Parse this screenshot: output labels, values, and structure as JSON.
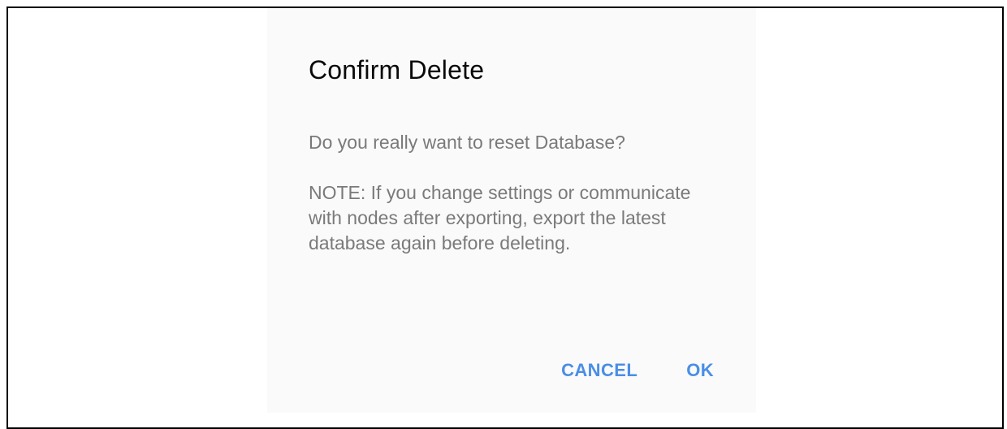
{
  "dialog": {
    "title": "Confirm Delete",
    "message": "Do you really want to reset Database?",
    "note": "NOTE: If you change settings or communicate with nodes after exporting, export the latest database again before deleting.",
    "buttons": {
      "cancel": "CANCEL",
      "ok": "OK"
    }
  },
  "colors": {
    "accent": "#4a8ee6",
    "dialog_background": "#fafafa",
    "body_text": "#7a7a7a"
  }
}
